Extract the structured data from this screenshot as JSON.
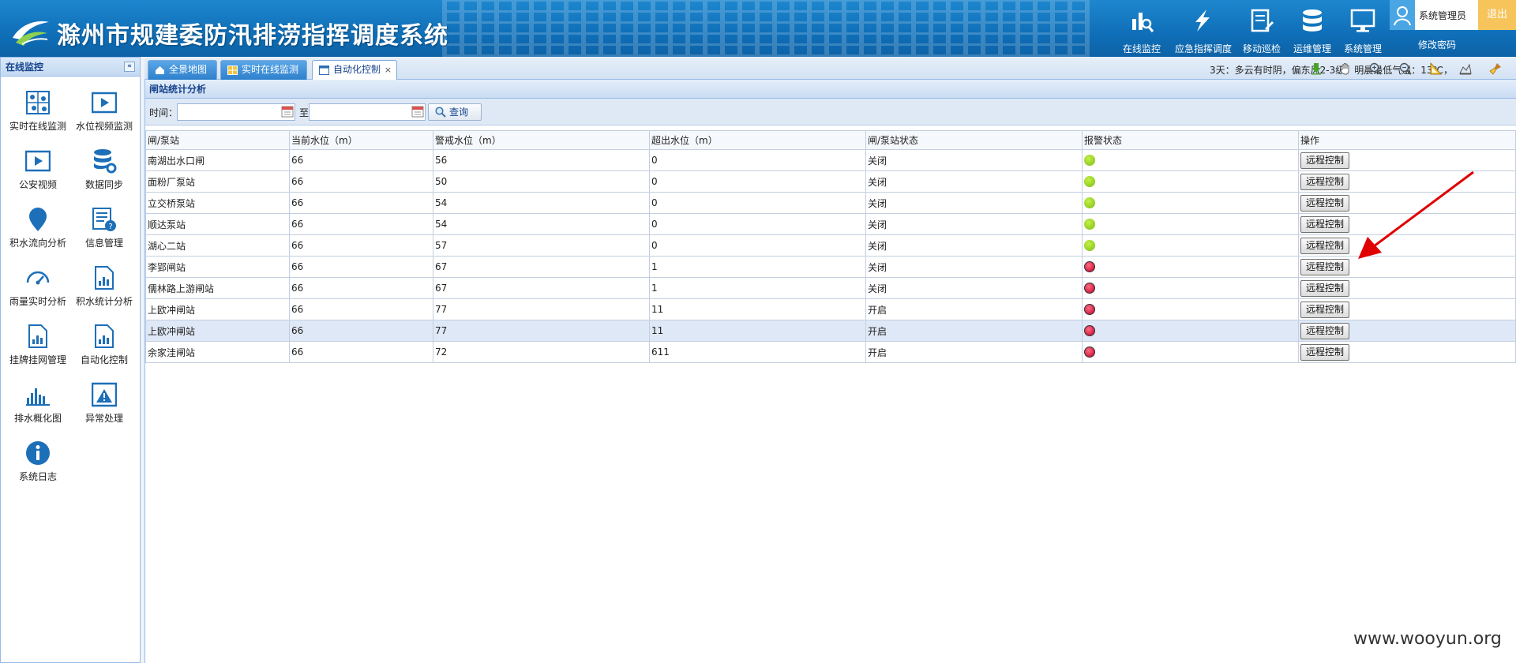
{
  "header": {
    "title": "滁州市规建委防汛排涝指挥调度系统",
    "nav": [
      {
        "label": "在线监控",
        "icon": "monitor-chart-icon"
      },
      {
        "label": "应急指挥调度",
        "icon": "lightning-icon"
      },
      {
        "label": "移动巡检",
        "icon": "document-edit-icon"
      },
      {
        "label": "运维管理",
        "icon": "database-icon"
      },
      {
        "label": "系统管理",
        "icon": "desktop-monitor-icon"
      }
    ],
    "user": "系统管理员",
    "logout": "退出",
    "change_password": "修改密码"
  },
  "sidebar": {
    "title": "在线监控",
    "collapse_symbol": "«",
    "items": [
      {
        "label": "实时在线监测",
        "icon": "map-pins-icon"
      },
      {
        "label": "水位视频监测",
        "icon": "video-play-icon"
      },
      {
        "label": "公安视频",
        "icon": "video-play-icon"
      },
      {
        "label": "数据同步",
        "icon": "database-gear-icon"
      },
      {
        "label": "积水流向分析",
        "icon": "water-drop-icon"
      },
      {
        "label": "信息管理",
        "icon": "list-help-icon"
      },
      {
        "label": "雨量实时分析",
        "icon": "gauge-icon"
      },
      {
        "label": "积水统计分析",
        "icon": "report-chart-icon"
      },
      {
        "label": "挂牌挂网管理",
        "icon": "report-chart-icon"
      },
      {
        "label": "自动化控制",
        "icon": "report-chart-icon"
      },
      {
        "label": "排水概化图",
        "icon": "bar-chart-icon"
      },
      {
        "label": "异常处理",
        "icon": "warning-window-icon"
      },
      {
        "label": "系统日志",
        "icon": "info-icon"
      }
    ]
  },
  "tabs": [
    {
      "label": "全景地图",
      "icon": "home-icon"
    },
    {
      "label": "实时在线监测",
      "icon": "grid-icon"
    },
    {
      "label": "自动化控制",
      "icon": "window-icon",
      "close": "×"
    }
  ],
  "weather": "3天：多云有时阴，偏东风2-3级，明晨最低气温：13℃，",
  "toolbar_icons": [
    "download-icon",
    "pan-hand-icon",
    "zoom-in-icon",
    "zoom-out-icon",
    "measure-icon",
    "area-icon",
    "clear-brush-icon"
  ],
  "panel": {
    "title": "闸站统计分析",
    "search": {
      "time_label": "时间：",
      "to_label": "至",
      "start_value": "",
      "end_value": "",
      "query_label": "查询"
    }
  },
  "table": {
    "headers": [
      "闸/泵站",
      "当前水位（m）",
      "警戒水位（m）",
      "超出水位（m）",
      "闸/泵站状态",
      "报警状态",
      "操作"
    ],
    "action_label": "远程控制",
    "rows": [
      {
        "name": "南湖出水口闸",
        "current": "66",
        "warning": "56",
        "exceed": "0",
        "status": "关闭",
        "alarm": "green"
      },
      {
        "name": "面粉厂泵站",
        "current": "66",
        "warning": "50",
        "exceed": "0",
        "status": "关闭",
        "alarm": "green"
      },
      {
        "name": "立交桥泵站",
        "current": "66",
        "warning": "54",
        "exceed": "0",
        "status": "关闭",
        "alarm": "green"
      },
      {
        "name": "顺达泵站",
        "current": "66",
        "warning": "54",
        "exceed": "0",
        "status": "关闭",
        "alarm": "green"
      },
      {
        "name": "湖心二站",
        "current": "66",
        "warning": "57",
        "exceed": "0",
        "status": "关闭",
        "alarm": "green"
      },
      {
        "name": "李郢闸站",
        "current": "66",
        "warning": "67",
        "exceed": "1",
        "status": "关闭",
        "alarm": "red"
      },
      {
        "name": "儒林路上游闸站",
        "current": "66",
        "warning": "67",
        "exceed": "1",
        "status": "关闭",
        "alarm": "red"
      },
      {
        "name": "上欧冲闸站",
        "current": "66",
        "warning": "77",
        "exceed": "11",
        "status": "开启",
        "alarm": "red"
      },
      {
        "name": "上欧冲闸站",
        "current": "66",
        "warning": "77",
        "exceed": "11",
        "status": "开启",
        "alarm": "red",
        "highlight": true
      },
      {
        "name": "余家洼闸站",
        "current": "66",
        "warning": "72",
        "exceed": "611",
        "status": "开启",
        "alarm": "red"
      }
    ]
  },
  "colors": {
    "header_blue": "#0f6fb8",
    "alarm_green": "#7bbd12",
    "alarm_red": "#c00025",
    "annotation_red": "#e00000"
  },
  "watermark": "www.wooyun.org"
}
